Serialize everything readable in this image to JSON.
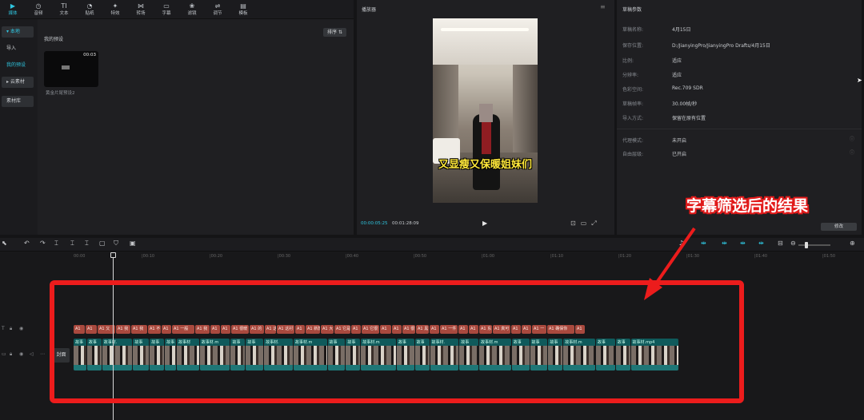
{
  "toolbar": {
    "items": [
      {
        "label": "媒体",
        "icon": "media-icon"
      },
      {
        "label": "音频",
        "icon": "audio-icon"
      },
      {
        "label": "文本",
        "icon": "text-icon"
      },
      {
        "label": "贴纸",
        "icon": "sticker-icon"
      },
      {
        "label": "特效",
        "icon": "effects-icon"
      },
      {
        "label": "转场",
        "icon": "transition-icon"
      },
      {
        "label": "字幕",
        "icon": "caption-icon"
      },
      {
        "label": "滤镜",
        "icon": "filter-icon"
      },
      {
        "label": "调节",
        "icon": "adjust-icon"
      },
      {
        "label": "模板",
        "icon": "template-icon"
      }
    ]
  },
  "sidebar": {
    "items": [
      {
        "label": "▾ 本地"
      },
      {
        "label": "导入"
      },
      {
        "label": "我的预设"
      },
      {
        "label": "▸ 云素材"
      },
      {
        "label": "素材库"
      }
    ]
  },
  "media": {
    "sort_label": "排序 ⇅",
    "section_title": "我的预设",
    "preset": {
      "duration": "00:03",
      "name": "黄金片尾预设2"
    }
  },
  "player": {
    "title": "播放器",
    "subtitle": "又显瘦又保暖姐妹们",
    "time_current": "00:00:05:25",
    "time_total": "00:01:28:09"
  },
  "params": {
    "title": "草稿参数",
    "rows": [
      {
        "label": "草稿名称:",
        "value": "4月15日"
      },
      {
        "label": "保存位置:",
        "value": "D:/JianyingPro/JianyingPro Drafts/4月15日"
      },
      {
        "label": "比例:",
        "value": "适应"
      },
      {
        "label": "分辨率:",
        "value": "适应"
      },
      {
        "label": "色彩空间:",
        "value": "Rec.709 SDR"
      },
      {
        "label": "草稿帧率:",
        "value": "30.00帧/秒"
      },
      {
        "label": "导入方式:",
        "value": "保留在原有位置"
      },
      {
        "label": "代理模式:",
        "value": "未开启"
      },
      {
        "label": "自由层级:",
        "value": "已开启"
      }
    ],
    "modify_label": "修改"
  },
  "annotation": {
    "label": "字幕筛选后的结果",
    "color": "#ec1c1c"
  },
  "timeline": {
    "ticks": [
      "00:00",
      "|00:10",
      "|00:20",
      "|00:30",
      "|00:40",
      "|00:50",
      "|01:00",
      "|01:10",
      "|01:20",
      "|01:30",
      "|01:40",
      "|01:50"
    ],
    "cover_label": "封面",
    "subtitle_clips": [
      "A1",
      "A1",
      "A1 又",
      "A1 我",
      "A1 我",
      "A1 不",
      "A1",
      "A1 一般",
      "A1 我",
      "A1",
      "A1",
      "A1 很暖",
      "A1 的",
      "A1 这",
      "A1 这衬",
      "A1",
      "A1 新款",
      "A1 大",
      "A1 它是",
      "A1",
      "A1 它很",
      "A1",
      "A1",
      "A1 很",
      "A1 黑",
      "A1",
      "A1 一件",
      "A1",
      "A1",
      "A1 东",
      "A1 真可",
      "A1",
      "A1",
      "A1 一",
      "A1 确保你",
      "A1"
    ],
    "video_clips": [
      "故事",
      "故事",
      "故事材.",
      "故事",
      "故事",
      "故事",
      "故事材",
      "故事材.m",
      "故事",
      "故事",
      "故事材.",
      "故事材.m",
      "故事",
      "故事",
      "故事材.m",
      "故事",
      "故事",
      "故事材.",
      "故事",
      "故事材.m",
      "故事",
      "故事",
      "故事",
      "故事材.m",
      "故事",
      "故事",
      "故事材.mp4"
    ]
  }
}
